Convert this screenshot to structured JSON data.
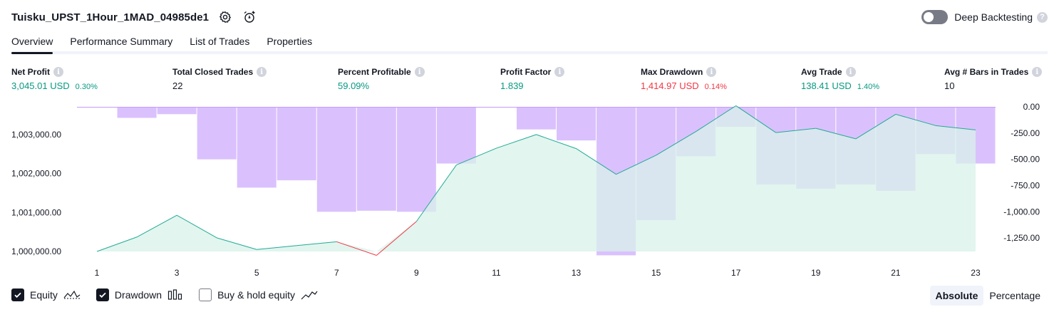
{
  "strategy_title": "Tuisku_UPST_1Hour_1MAD_04985de1",
  "deep_backtesting_label": "Deep Backtesting",
  "help_glyph": "?",
  "info_glyph": "i",
  "tabs": [
    "Overview",
    "Performance Summary",
    "List of Trades",
    "Properties"
  ],
  "metrics": [
    {
      "label": "Net Profit",
      "value": "3,045.01 USD",
      "sub": "0.30%",
      "tone": "pos"
    },
    {
      "label": "Total Closed Trades",
      "value": "22",
      "sub": "",
      "tone": "neu"
    },
    {
      "label": "Percent Profitable",
      "value": "59.09%",
      "sub": "",
      "tone": "pos"
    },
    {
      "label": "Profit Factor",
      "value": "1.839",
      "sub": "",
      "tone": "pos"
    },
    {
      "label": "Max Drawdown",
      "value": "1,414.97 USD",
      "sub": "0.14%",
      "tone": "neg"
    },
    {
      "label": "Avg Trade",
      "value": "138.41 USD",
      "sub": "1.40%",
      "tone": "pos"
    },
    {
      "label": "Avg # Bars in Trades",
      "value": "10",
      "sub": "",
      "tone": "neu"
    }
  ],
  "legend": [
    {
      "label": "Equity",
      "checked": true,
      "icon": "equity-line-icon"
    },
    {
      "label": "Drawdown",
      "checked": true,
      "icon": "drawdown-bars-icon"
    },
    {
      "label": "Buy & hold equity",
      "checked": false,
      "icon": "buy-hold-line-icon"
    }
  ],
  "modes": [
    "Absolute",
    "Percentage"
  ],
  "colors": {
    "equity_line": "#22ab94",
    "equity_fill": "#d8f1ea",
    "equity_negative": "#f23645",
    "drawdown_bar": "#c49bfb",
    "accent": "#131722"
  },
  "chart_data": {
    "type": "area",
    "x": [
      1,
      2,
      3,
      4,
      5,
      6,
      7,
      8,
      9,
      10,
      11,
      12,
      13,
      14,
      15,
      16,
      17,
      18,
      19,
      20,
      21,
      22,
      23
    ],
    "x_tick_labels": [
      "1",
      "3",
      "5",
      "7",
      "9",
      "11",
      "13",
      "15",
      "17",
      "19",
      "21",
      "23"
    ],
    "series": [
      {
        "name": "Equity",
        "axis": "left",
        "values": [
          1000000,
          1000370,
          1000930,
          1000350,
          1000050,
          1000150,
          1000250,
          999900,
          1000770,
          1002220,
          1002650,
          1003000,
          1002640,
          1001980,
          1002470,
          1003080,
          1003740,
          1003050,
          1003160,
          1002890,
          1003520,
          1003230,
          1003120
        ]
      },
      {
        "name": "Drawdown",
        "axis": "right",
        "values": [
          0,
          -105,
          -70,
          -500,
          -770,
          -700,
          -1000,
          -990,
          -1000,
          -540,
          0,
          -215,
          -320,
          -1414.97,
          -1080,
          -470,
          -190,
          -740,
          -780,
          -740,
          -800,
          -450,
          -540
        ]
      }
    ],
    "left_axis": {
      "ticks": [
        1000000,
        1001000,
        1002000,
        1003000
      ],
      "tick_labels": [
        "1,000,000.00",
        "1,001,000.00",
        "1,002,000.00",
        "1,003,000.00"
      ]
    },
    "right_axis": {
      "ticks": [
        0,
        -250,
        -500,
        -750,
        -1000,
        -1250
      ],
      "tick_labels": [
        "0.00",
        "-250.00",
        "-500.00",
        "-750.00",
        "-1,000.00",
        "-1,250.00"
      ]
    }
  }
}
